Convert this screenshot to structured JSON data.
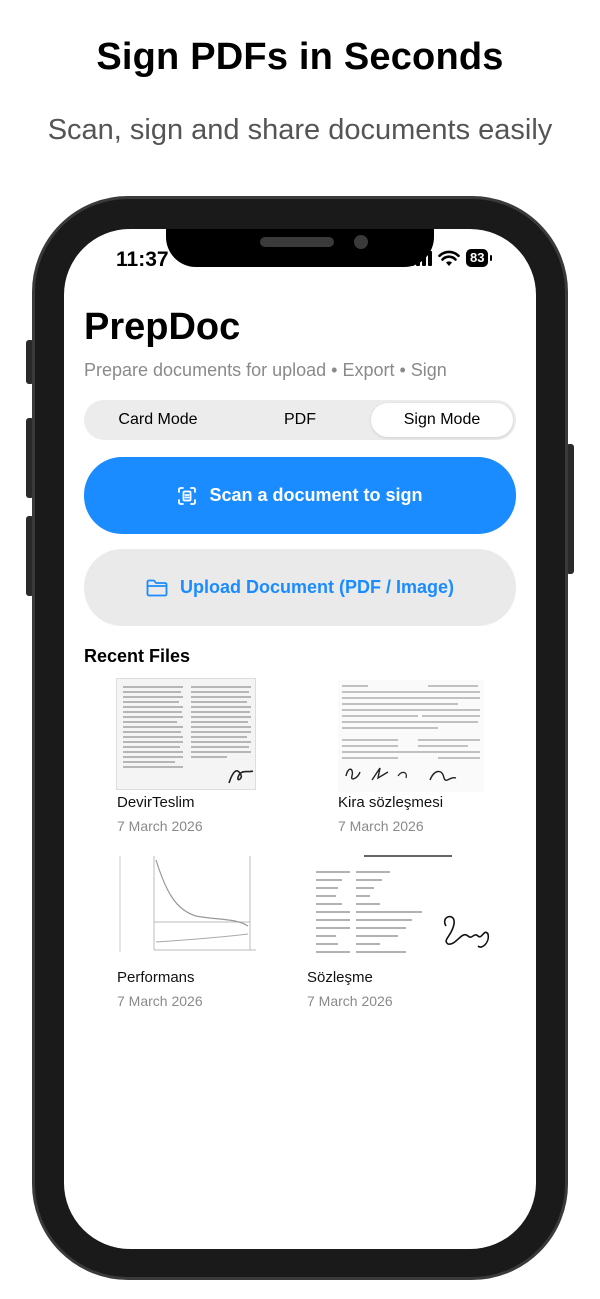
{
  "promo": {
    "title": "Sign PDFs in Seconds",
    "subtitle": "Scan, sign and share documents easily"
  },
  "status_bar": {
    "time": "11:37",
    "battery": "83"
  },
  "app": {
    "title": "PrepDoc",
    "subtitle": "Prepare documents for upload • Export • Sign"
  },
  "modes": {
    "items": [
      "Card Mode",
      "PDF",
      "Sign Mode"
    ],
    "selected": "Sign Mode"
  },
  "actions": {
    "scan_label": "Scan a document to sign",
    "upload_label": "Upload Document (PDF / Image)"
  },
  "recent": {
    "heading": "Recent Files",
    "files": [
      {
        "name": "DevirTeslim",
        "date": "7 March 2026"
      },
      {
        "name": "Kira sözleşmesi",
        "date": "7 March 2026"
      },
      {
        "name": "Performans",
        "date": "7 March 2026"
      },
      {
        "name": "Sözleşme",
        "date": "7 March 2026"
      }
    ]
  },
  "colors": {
    "accent": "#1a8cff",
    "muted_text": "#8a8a8a",
    "segment_bg": "#ececec"
  }
}
